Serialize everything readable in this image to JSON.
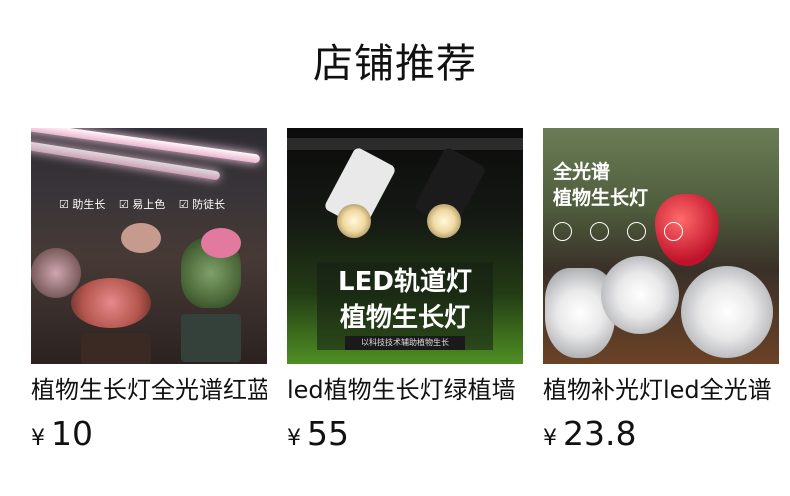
{
  "section": {
    "title": "店铺推荐"
  },
  "products": [
    {
      "name": "植物生长灯全光谱红蓝",
      "currency": "¥",
      "price": "10",
      "image": {
        "labels": [
          "☑ 助生长",
          "☑ 易上色",
          "☑ 防徒长"
        ]
      }
    },
    {
      "name": "led植物生长灯绿植墙",
      "currency": "¥",
      "price": "55",
      "image": {
        "line1": "LED轨道灯",
        "line2": "植物生长灯",
        "tagline": "以科技技术辅助植物生长"
      }
    },
    {
      "name": "植物补光灯led全光谱",
      "currency": "¥",
      "price": "23.8",
      "image": {
        "line1": "全光谱",
        "line2": "植物生长灯"
      }
    }
  ]
}
